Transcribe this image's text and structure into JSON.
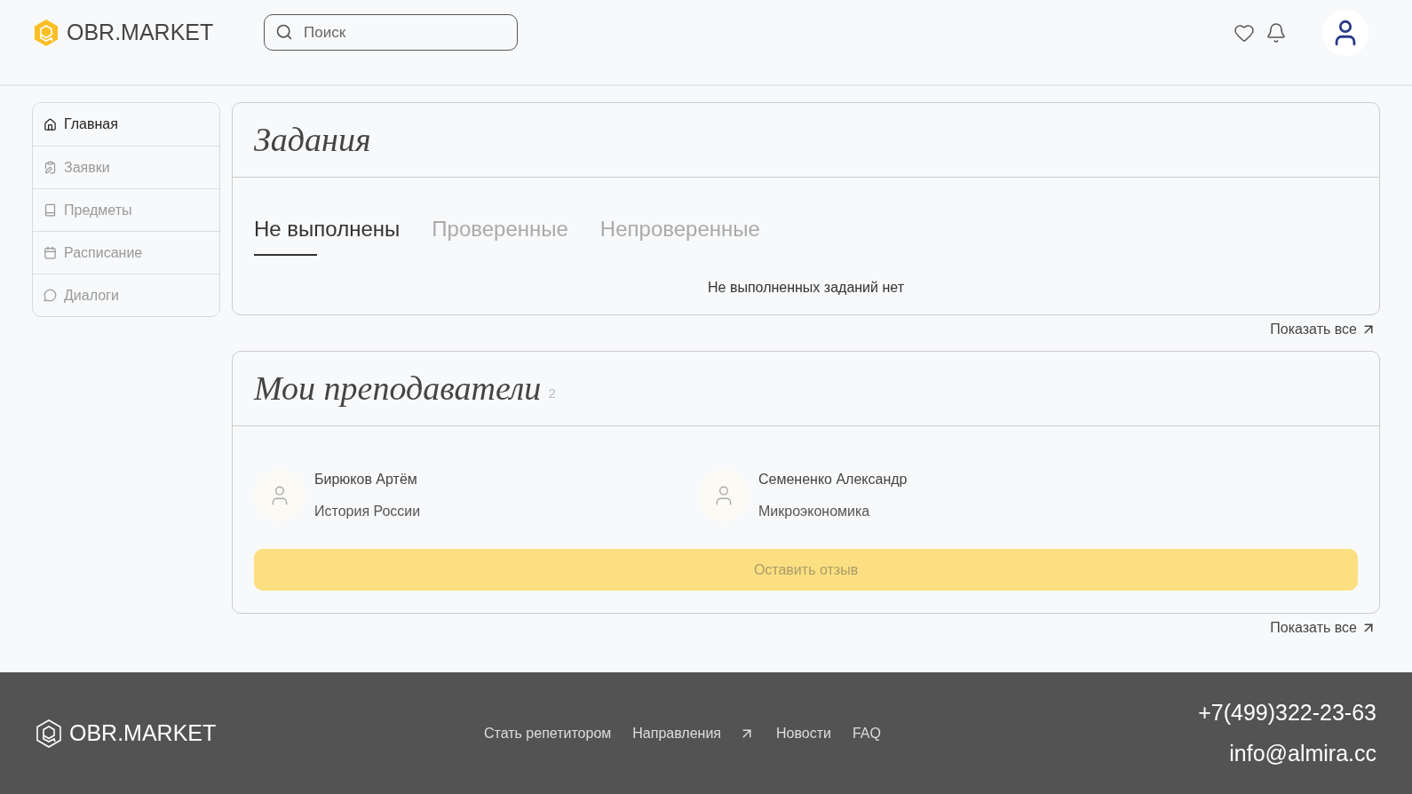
{
  "header": {
    "logo": "OBR.MARKET",
    "search": {
      "placeholder": "Поиск"
    }
  },
  "sidebar": {
    "items": [
      {
        "label": "Главная",
        "selected": true
      },
      {
        "label": "Заявки",
        "selected": false
      },
      {
        "label": "Предметы",
        "selected": false
      },
      {
        "label": "Расписание",
        "selected": false
      },
      {
        "label": "Диалоги",
        "selected": false
      }
    ]
  },
  "tasks": {
    "title": "Задания",
    "tabs": [
      {
        "label": "Не выполнены",
        "selected": true
      },
      {
        "label": "Проверенные",
        "selected": false
      },
      {
        "label": "Непроверенные",
        "selected": false
      }
    ],
    "empty": "Не выполненных заданий нет",
    "show_all": "Показать все"
  },
  "teachers": {
    "title": "Мои преподаватели",
    "count": "2",
    "items": [
      {
        "name": "Бирюков Артём",
        "subject": "История России"
      },
      {
        "name": "Семененко Александр",
        "subject": "Микроэкономика"
      }
    ],
    "review_button": {
      "label": "Оставить отзыв",
      "disabled": true
    },
    "show_all": "Показать все"
  },
  "footer": {
    "logo": "OBR.MARKET",
    "links": [
      {
        "label": "Стать репетитором",
        "external": false
      },
      {
        "label": "Направления",
        "external": true
      },
      {
        "label": "Новости",
        "external": false
      },
      {
        "label": "FAQ",
        "external": false
      }
    ],
    "phone": "+7(499)322-23-63",
    "email": "info@almira.cc"
  }
}
